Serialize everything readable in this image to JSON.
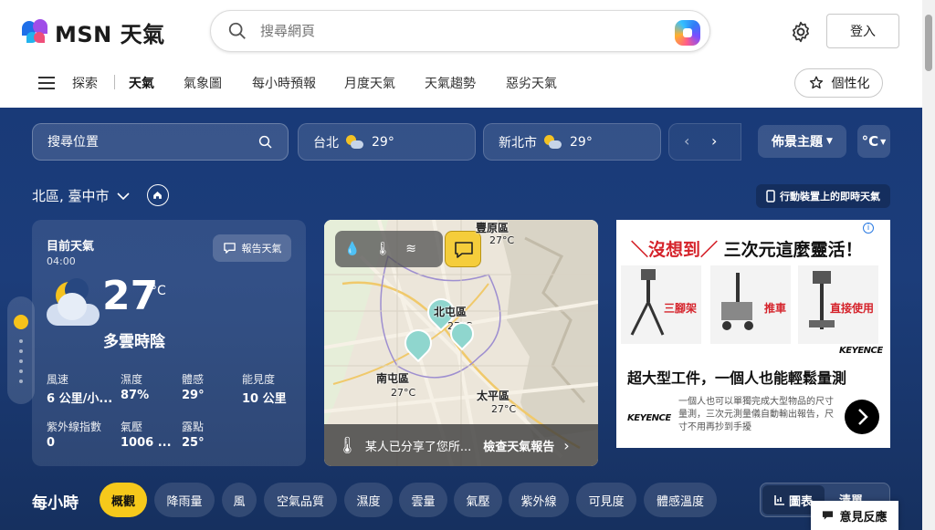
{
  "header": {
    "logo_text": "MSN 天氣",
    "search_placeholder": "搜尋網頁",
    "login_label": "登入",
    "personalize_label": "個性化"
  },
  "nav": {
    "items": [
      "探索",
      "天氣",
      "氣象圖",
      "每小時預報",
      "月度天氣",
      "天氣趨勢",
      "惡劣天氣"
    ],
    "active": "天氣"
  },
  "toolbar": {
    "location_search_placeholder": "搜尋位置",
    "saved_locations": [
      {
        "name": "台北",
        "temp": "29°"
      },
      {
        "name": "新北市",
        "temp": "29°"
      }
    ],
    "prev_arrow": "‹",
    "next_arrow": "›",
    "theme_label": "佈景主題",
    "unit_label": "°C"
  },
  "location": {
    "name": "北區, 臺中市",
    "mobile_label": "行動裝置上的即時天氣"
  },
  "current": {
    "title": "目前天氣",
    "time": "04:00",
    "report_label": "報告天氣",
    "temp": "27",
    "unit": "°C",
    "condition": "多雲時陰",
    "stats": [
      {
        "label": "風速",
        "value": "6 公里/小..."
      },
      {
        "label": "濕度",
        "value": "87%"
      },
      {
        "label": "體感",
        "value": "29°"
      },
      {
        "label": "能見度",
        "value": "10 公里"
      },
      {
        "label": "紫外線指數",
        "value": "0"
      },
      {
        "label": "氣壓",
        "value": "1006 ..."
      },
      {
        "label": "露點",
        "value": "25°"
      }
    ]
  },
  "map": {
    "places": [
      {
        "name": "豐原區",
        "temp": "27°C"
      },
      {
        "name": "北屯區",
        "temp": "27°C"
      },
      {
        "name": "南屯區",
        "temp": "27°C"
      },
      {
        "name": "太平區",
        "temp": "27°C"
      }
    ],
    "share_text": "某人已分享了您所...",
    "check_report": "檢查天氣報告"
  },
  "ad": {
    "headline_red": "沒想到",
    "headline_black": "三次元這麼靈活！",
    "products": [
      "三腳架",
      "推車",
      "直接使用"
    ],
    "brand": "KEYENCE",
    "tagline": "超大型工件，一個人也能輕鬆量測",
    "body": "一個人也可以單獨完成大型物品的尺寸量測，三次元測量儀自動輸出報告，尺寸不用再抄到手擾"
  },
  "hourly": {
    "title": "每小時",
    "tabs": [
      "概觀",
      "降雨量",
      "風",
      "空氣品質",
      "濕度",
      "雲量",
      "氣壓",
      "紫外線",
      "可見度",
      "體感溫度"
    ],
    "active_tab": "概觀",
    "view_chart": "圖表",
    "view_list": "清單"
  },
  "feedback_label": "意見反應",
  "colors": {
    "accent_yellow": "#f6c91b",
    "weather_bg": "#193a78"
  }
}
